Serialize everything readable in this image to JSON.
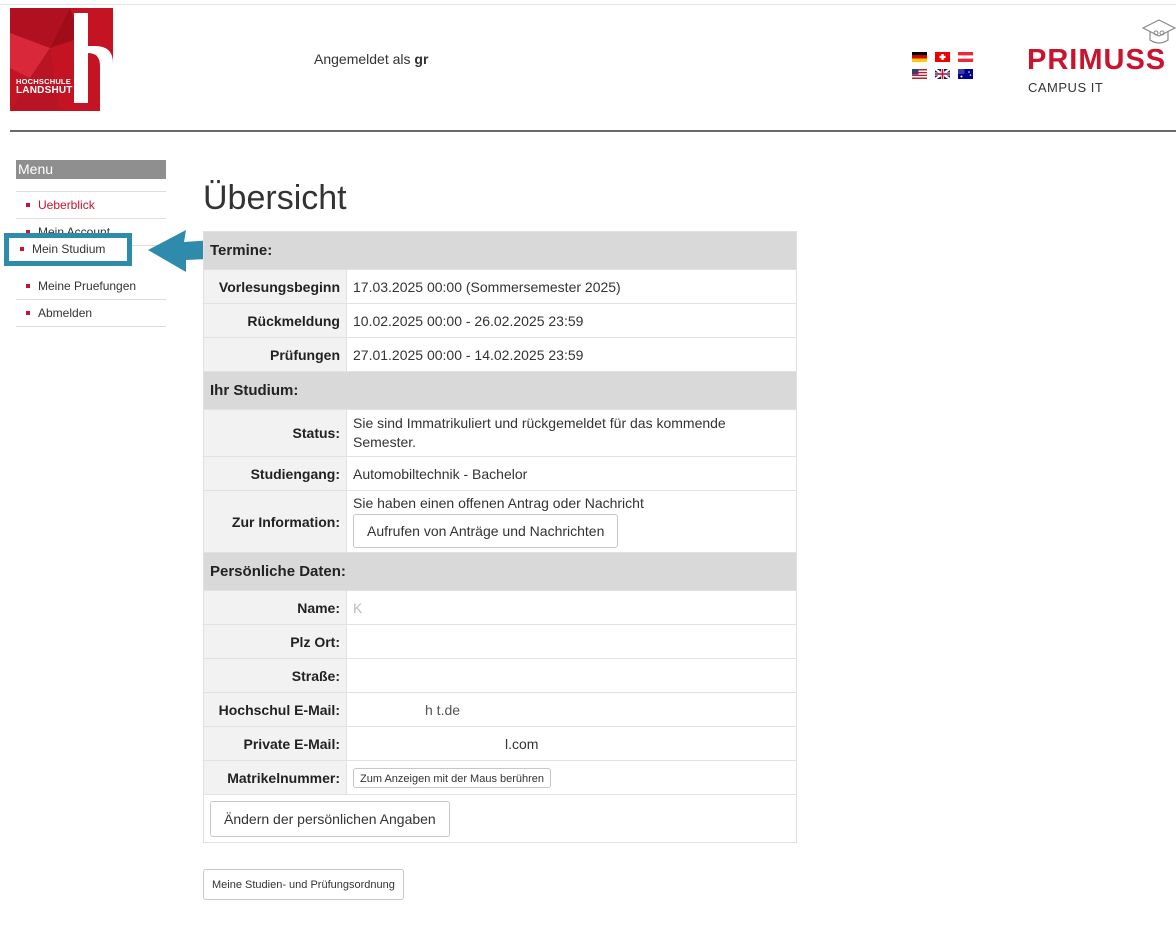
{
  "header": {
    "logo_line1": "HOCHSCHULE",
    "logo_line2": "LANDSHUT",
    "logged_in_prefix": "Angemeldet als ",
    "logged_in_user": "gr",
    "brand_name": "PRIMUSS",
    "brand_sub": "CAMPUS IT"
  },
  "sidebar": {
    "title": "Menu",
    "items": [
      {
        "label": "Ueberblick"
      },
      {
        "label": "Mein Account"
      },
      {
        "label": "Mein Studium"
      },
      {
        "label": "Meine Pruefungen"
      },
      {
        "label": "Abmelden"
      }
    ]
  },
  "main": {
    "title": "Übersicht",
    "sections": {
      "termine": "Termine:",
      "studium": "Ihr Studium:",
      "persoenlich": "Persönliche Daten:"
    },
    "termine": {
      "vorlesungsbeginn_label": "Vorlesungsbeginn",
      "vorlesungsbeginn_value": "17.03.2025 00:00 (Sommersemester 2025)",
      "rueckmeldung_label": "Rückmeldung",
      "rueckmeldung_value": "10.02.2025 00:00 - 26.02.2025 23:59",
      "pruefungen_label": "Prüfungen",
      "pruefungen_value": "27.01.2025 00:00 - 14.02.2025 23:59"
    },
    "studium": {
      "status_label": "Status:",
      "status_value": "Sie sind Immatrikuliert und rückgemeldet für das kommende Semester.",
      "studiengang_label": "Studiengang:",
      "studiengang_value": "Automobiltechnik - Bachelor",
      "info_label": "Zur Information:",
      "info_value": "Sie haben einen offenen Antrag oder Nachricht",
      "info_button": "Aufrufen von Anträge und Nachrichten"
    },
    "persoenlich": {
      "name_label": "Name:",
      "name_value": "K",
      "plz_label": "Plz Ort:",
      "strasse_label": "Straße:",
      "hs_email_label": "Hochschul E-Mail:",
      "hs_email_value": "h       t.de",
      "private_email_label": "Private E-Mail:",
      "private_email_value": "l.com",
      "matrikel_label": "Matrikelnummer:",
      "matrikel_button": "Zum Anzeigen mit der Maus berühren",
      "edit_button": "Ändern der persönlichen Angaben"
    },
    "bottom_button": "Meine Studien- und Prüfungsordnung"
  },
  "colors": {
    "brand_red": "#c8142c",
    "logo_red": "#c41424",
    "highlight_blue": "#2e8bab",
    "section_gray": "#d9d9d9",
    "menu_header_gray": "#8f8f8f"
  },
  "icons": [
    "flag-de-icon",
    "flag-ch-icon",
    "flag-at-icon",
    "flag-us-icon",
    "flag-uk-icon",
    "flag-au-icon",
    "graduation-cap-icon",
    "arrow-icon"
  ]
}
